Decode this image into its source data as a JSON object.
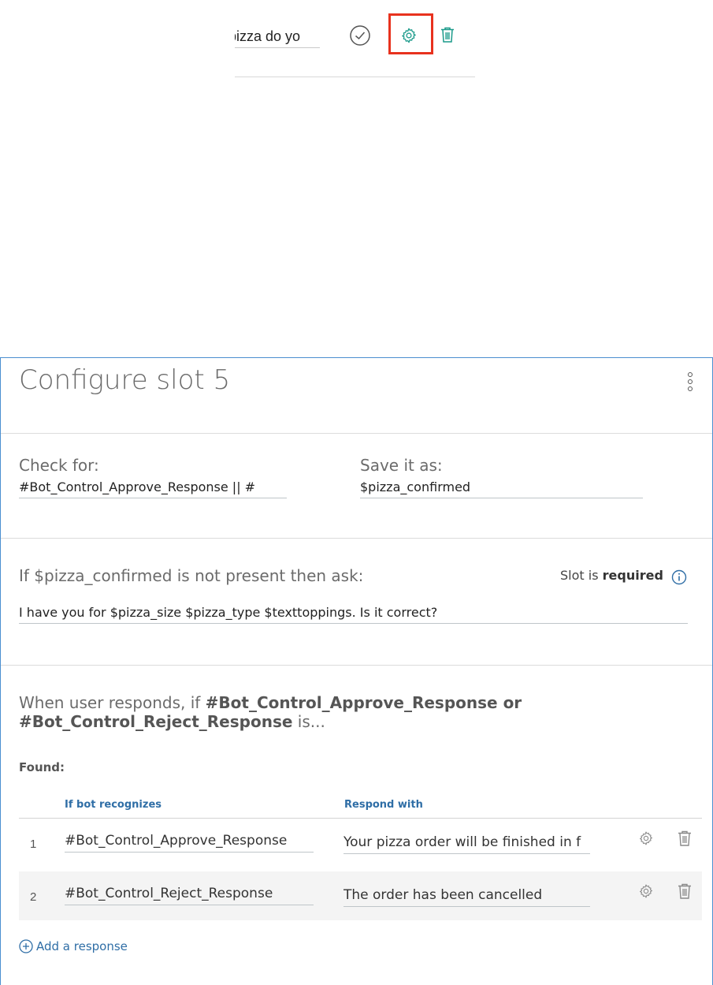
{
  "top": {
    "prompt_input_value": "pizza do yo"
  },
  "panel": {
    "title": "Configure slot 5",
    "check_for_label": "Check for:",
    "check_for_value": "#Bot_Control_Approve_Response || #",
    "save_as_label": "Save it as:",
    "save_as_value": "$pizza_confirmed",
    "ask_label": "If $pizza_confirmed is not present then ask:",
    "slot_is": "Slot is",
    "required": "required",
    "prompt_value": "I have you for $pizza_size $pizza_type $texttoppings. Is it correct?",
    "when_prefix": "When user responds, if",
    "when_intents": "#Bot_Control_Approve_Response or #Bot_Control_Reject_Response",
    "when_suffix": "is...",
    "found_label": "Found:",
    "col_condition": "If bot recognizes",
    "col_response": "Respond with",
    "rows": [
      {
        "num": "1",
        "condition": "#Bot_Control_Approve_Response",
        "response": "Your pizza order will be finished in f"
      },
      {
        "num": "2",
        "condition": "#Bot_Control_Reject_Response",
        "response": "The order has been cancelled"
      }
    ],
    "add_response": "Add a response"
  },
  "colors": {
    "highlight": "#e8321e",
    "accent_teal": "#1a9a8a",
    "link_blue": "#2f6ea6",
    "panel_border": "#4b8fd0"
  }
}
